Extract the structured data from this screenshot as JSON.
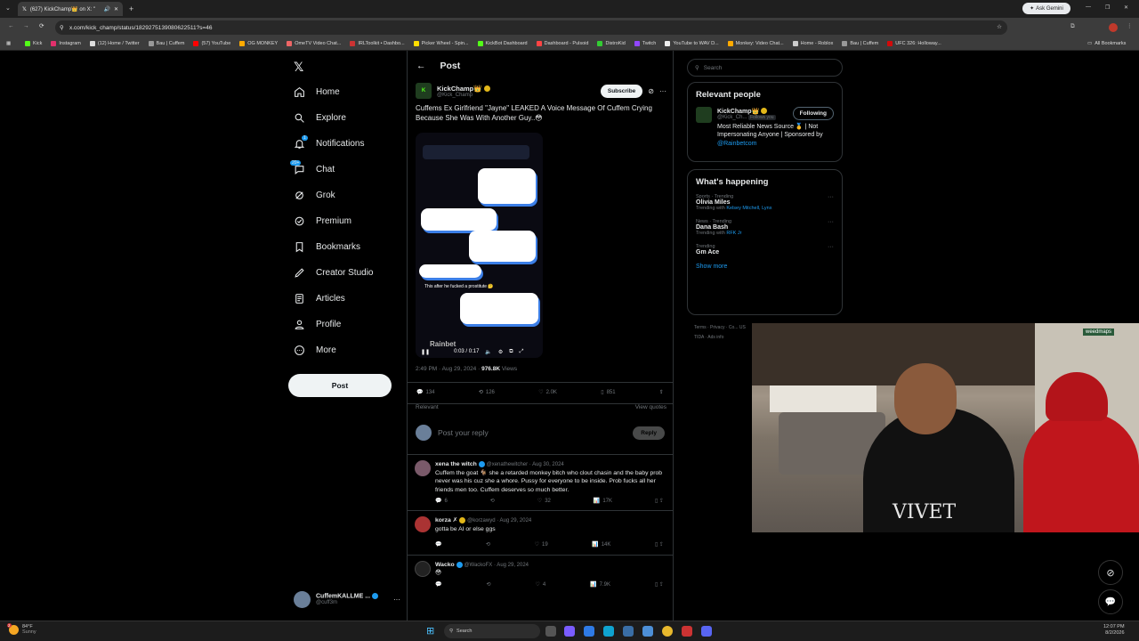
{
  "browser": {
    "tab_title": "(627) KickChamp👑 on X: \"",
    "url": "x.com/kick_champ/status/1829275139080622511?s=46",
    "ask_gemini": "Ask Gemini",
    "all_bookmarks": "All Bookmarks",
    "bookmarks": [
      "Kick",
      "Instagram",
      "(12) Home / Twitter",
      "Bau | Cuffem",
      "(57) YouTube",
      "OG MONKEY",
      "OmeTV Video Chat...",
      "IRLToolkit • Dashbo...",
      "Picker Wheel - Spin...",
      "KickBot Dashboard",
      "Dashboard - Pulsoid",
      "DistroKid",
      "Twitch",
      "YouTube to WAV D...",
      "Monkey: Video Chat...",
      "Home - Roblox",
      "Bau | Cuffem",
      "UFC 326: Holloway..."
    ]
  },
  "nav": {
    "items": [
      "Home",
      "Explore",
      "Notifications",
      "Chat",
      "Grok",
      "Premium",
      "Bookmarks",
      "Creator Studio",
      "Articles",
      "Profile",
      "More"
    ],
    "notif_badge": "1",
    "chat_badge": "20+",
    "post_button": "Post",
    "account_name": "CuffemKALLME ...",
    "account_handle": "@cuff3m"
  },
  "post": {
    "header": "Post",
    "author_name": "KickChamp👑",
    "author_handle": "@Kick_Champ",
    "subscribe": "Subscribe",
    "text": "Cuffems Ex Girlfriend \"Jayne\" LEAKED A Voice Message Of Cuffem Crying Because She Was With Another Guy..😳",
    "video_time": "0:03 / 0:17",
    "video_caption": "This after he fucked a prostitute 🤔",
    "video_watermark": "Rainbet",
    "meta_time": "2:49 PM · Aug 29, 2024 · ",
    "meta_views": "976.8K",
    "meta_views_label": " Views",
    "stats": {
      "replies": "134",
      "reposts": "126",
      "likes": "2.0K",
      "bookmarks": "851"
    },
    "relevant": "Relevant",
    "view_quotes": "View quotes",
    "reply_placeholder": "Post your reply",
    "reply_button": "Reply"
  },
  "replies": [
    {
      "name": "xena the witch",
      "handle": "@xenathewitcher · Aug 30, 2024",
      "text": "Cuffem the goat 🐐 she a retarded monkey bitch who clout chasin and the baby prob never was his cuz she a whore. Pussy for everyone to be inside. Prob fucks all her friends men too. Cuffem deserves so much better.",
      "replies": "6",
      "reposts": "",
      "likes": "32",
      "views": "17K"
    },
    {
      "name": "korza ✗",
      "handle": "@korzawyd · Aug 29, 2024",
      "text": "gotta be AI or else ggs",
      "replies": "",
      "reposts": "",
      "likes": "19",
      "views": "14K"
    },
    {
      "name": "Wacko",
      "handle": "@WackoFX · Aug 29, 2024",
      "text": "😳",
      "replies": "",
      "reposts": "",
      "likes": "4",
      "views": "7.9K"
    }
  ],
  "right": {
    "search_placeholder": "Search",
    "relevant_title": "Relevant people",
    "person_name": "KickChamp👑",
    "person_handle": "@Kick_Ch...",
    "follows_you": "Follows you",
    "following": "Following",
    "person_bio": "Most Reliable News Source 🥇 | Not Impersonating Anyone | Sponsored by ",
    "person_bio_link": "@Rainbetcom",
    "happening_title": "What's happening",
    "trends": [
      {
        "cat": "Sports · Trending",
        "name": "Olivia Miles",
        "with_label": "Trending with ",
        "with": "Kelsey Mitchell, Lynx"
      },
      {
        "cat": "News · Trending",
        "name": "Dana Bash",
        "with_label": "Trending with ",
        "with": "RFK Jr"
      },
      {
        "cat": "Trending",
        "name": "Gm Ace",
        "with_label": "",
        "with": ""
      }
    ],
    "show_more": "Show more",
    "footer": "Terms · Privacy · Co... US TIDA · Ads info"
  },
  "webcam": {
    "shirt_text": "VIVET",
    "sign_text": "weedmaps"
  },
  "taskbar": {
    "temp": "84°F",
    "weather": "Sunny",
    "weather_badge": "2",
    "search": "Search",
    "time": "12:07 PM",
    "date": "8/2/2026"
  },
  "colors": {
    "accent": "#1d9bf0",
    "bg": "#000000",
    "border": "#2f3336",
    "muted": "#71767b"
  }
}
